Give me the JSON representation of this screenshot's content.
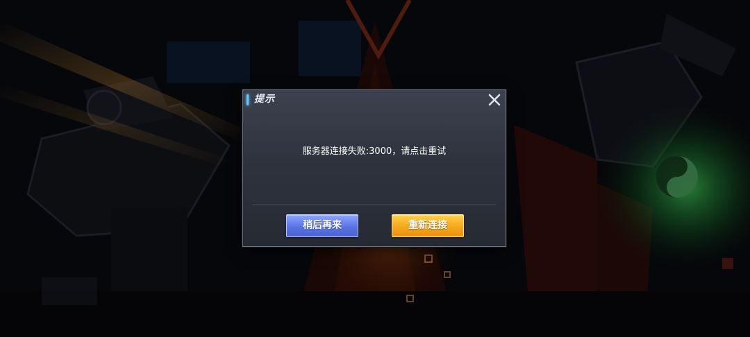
{
  "dialog": {
    "title": "提示",
    "message": "服务器连接失败:3000，请点击重试",
    "later_button": "稍后再来",
    "retry_button": "重新连接",
    "close_icon": "close-icon"
  },
  "colors": {
    "accent": "#64c9ff",
    "later_button": "#5a74e6",
    "retry_button": "#f5a71c"
  }
}
